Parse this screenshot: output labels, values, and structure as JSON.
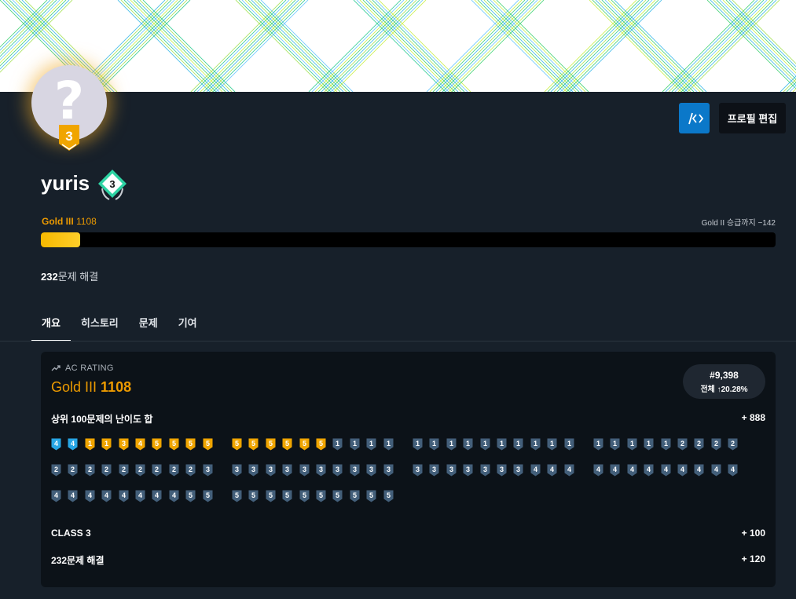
{
  "profile": {
    "username": "yuris",
    "avatar_glyph": "?",
    "avatar_badge_level": "3",
    "name_badge_level": "3",
    "tier_name": "Gold III",
    "tier_value": "1108",
    "next_tier_text": "Gold II 승급까지 −142",
    "progress_fraction": 0.053,
    "solved_count": "232",
    "solved_suffix": "문제 해결"
  },
  "buttons": {
    "code_icon": "code-icon",
    "edit_label": "프로필 편집"
  },
  "tabs": [
    {
      "label": "개요"
    },
    {
      "label": "히스토리"
    },
    {
      "label": "문제"
    },
    {
      "label": "기여"
    }
  ],
  "ac_rating": {
    "label": "AC RATING",
    "tier_name": "Gold III",
    "value": "1108",
    "rank": "#9,398",
    "rank_detail": "전체 ↑20.28%",
    "top100_label": "상위 100문제의 난이도 합",
    "top100_value": "+ 888",
    "class_label": "CLASS 3",
    "class_value": "+ 100",
    "solved_label": "232문제 해결",
    "solved_value": "+ 120"
  },
  "tier_icons": {
    "rows": [
      [
        "P4",
        "P4",
        "G1",
        "G1",
        "G3",
        "G4",
        "G5",
        "G5",
        "G5",
        "G5",
        "G5",
        "G5",
        "G5",
        "G5",
        "G5",
        "G5",
        "S1",
        "S1",
        "S1",
        "S1",
        "S1",
        "S1",
        "S1",
        "S1",
        "S1",
        "S1",
        "S1",
        "S1",
        "S1",
        "S1",
        "S1",
        "S1",
        "S1",
        "S1",
        "S1",
        "S2",
        "S2",
        "S2",
        "S2"
      ],
      [
        "S2",
        "S2",
        "S2",
        "S2",
        "S2",
        "S2",
        "S2",
        "S2",
        "S2",
        "S3",
        "S3",
        "S3",
        "S3",
        "S3",
        "S3",
        "S3",
        "S3",
        "S3",
        "S3",
        "S3",
        "S3",
        "S3",
        "S3",
        "S3",
        "S3",
        "S3",
        "S3",
        "S4",
        "S4",
        "S4",
        "S4",
        "S4",
        "S4",
        "S4",
        "S4",
        "S4",
        "S4",
        "S4",
        "S4"
      ],
      [
        "S4",
        "S4",
        "S4",
        "S4",
        "S4",
        "S4",
        "S4",
        "S4",
        "S5",
        "S5",
        "S5",
        "S5",
        "S5",
        "S5",
        "S5",
        "S5",
        "S5",
        "S5",
        "S5",
        "S5"
      ]
    ]
  },
  "colors": {
    "gold": "#ec9a00",
    "gold_badge": "#f0a500",
    "silver_badge": "#435f7a",
    "platinum_badge": "#27a6e5",
    "code_button": "#0b78c9",
    "name_badge": "#2ed3a3"
  }
}
